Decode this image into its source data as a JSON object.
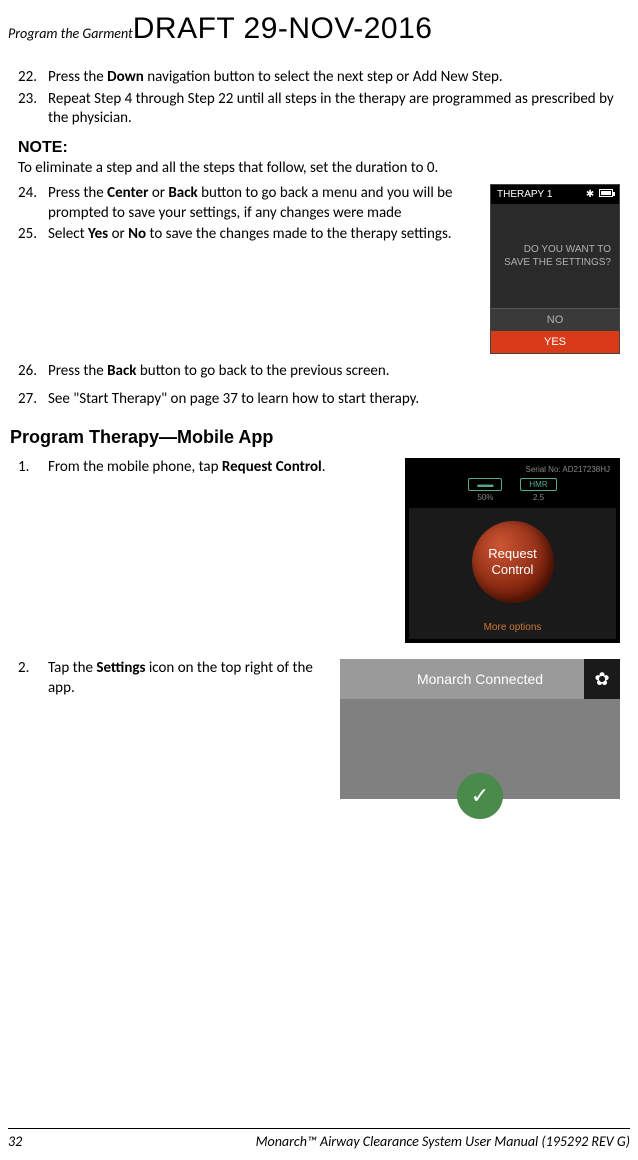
{
  "header": {
    "left": "Program the Garment",
    "draft": "DRAFT 29-NOV-2016"
  },
  "steps_22_23": [
    {
      "num": "22.",
      "text_before": "Press the ",
      "bold1": "Down",
      "text_after": " navigation button to select the next step or Add New Step."
    },
    {
      "num": "23.",
      "text": "Repeat Step 4 through Step 22 until all steps in the therapy are programmed as prescribed by the physician."
    }
  ],
  "note": {
    "label": "NOTE:",
    "text": "To eliminate a step and all the steps that follow, set the duration to 0."
  },
  "steps_24_25": [
    {
      "num": "24.",
      "p1": "Press the ",
      "b1": "Center",
      "p2": " or ",
      "b2": "Back",
      "p3": " button to go back a menu and you will be prompted to save your settings, if any changes were made"
    },
    {
      "num": "25.",
      "p1": "Select ",
      "b1": "Yes",
      "p2": " or ",
      "b2": "No",
      "p3": " to save the changes made to the therapy settings."
    }
  ],
  "device1": {
    "title": "THERAPY 1",
    "question": "DO YOU WANT TO SAVE THE SETTINGS?",
    "no": "NO",
    "yes": "YES"
  },
  "step26": {
    "num": "26.",
    "p1": "Press the ",
    "b1": "Back",
    "p2": " button to go back to the previous screen."
  },
  "step27": {
    "num": "27.",
    "text": "See \"Start Therapy\" on page 37 to learn how to start therapy."
  },
  "section_heading": "Program Therapy—Mobile App",
  "mobile1": {
    "num": "1.",
    "p1": "From the mobile phone, tap ",
    "b1": "Request Control",
    "p2": "."
  },
  "app1": {
    "serial": "Serial No: AD217238HJ",
    "battery_val": "50%",
    "hmr_val": "2.5",
    "hmr_label": "HMR",
    "button_l1": "Request",
    "button_l2": "Control",
    "more": "More options"
  },
  "mobile2": {
    "num": "2.",
    "p1": "Tap the ",
    "b1": "Settings",
    "p2": " icon on the top right of the app."
  },
  "app2": {
    "title": "Monarch Connected"
  },
  "footer": {
    "page": "32",
    "text": "Monarch™ Airway Clearance System User Manual (195292 REV G)"
  }
}
